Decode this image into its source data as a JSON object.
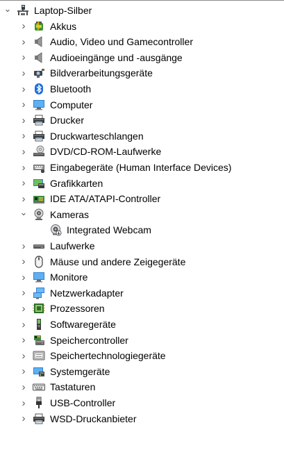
{
  "root": {
    "label": "Laptop-Silber",
    "icon": "computer-tree-icon",
    "expanded": true
  },
  "categories": [
    {
      "label": "Akkus",
      "icon": "battery-icon",
      "expanded": false
    },
    {
      "label": "Audio, Video und Gamecontroller",
      "icon": "speaker-icon",
      "expanded": false
    },
    {
      "label": "Audioeingänge und -ausgänge",
      "icon": "speaker-icon",
      "expanded": false
    },
    {
      "label": "Bildverarbeitungsgeräte",
      "icon": "camera-device-icon",
      "expanded": false
    },
    {
      "label": "Bluetooth",
      "icon": "bluetooth-icon",
      "expanded": false
    },
    {
      "label": "Computer",
      "icon": "monitor-icon",
      "expanded": false
    },
    {
      "label": "Drucker",
      "icon": "printer-icon",
      "expanded": false
    },
    {
      "label": "Druckwarteschlangen",
      "icon": "printer-icon",
      "expanded": false
    },
    {
      "label": "DVD/CD-ROM-Laufwerke",
      "icon": "dvd-drive-icon",
      "expanded": false
    },
    {
      "label": "Eingabegeräte (Human Interface Devices)",
      "icon": "hid-icon",
      "expanded": false
    },
    {
      "label": "Grafikkarten",
      "icon": "display-adapter-icon",
      "expanded": false
    },
    {
      "label": "IDE ATA/ATAPI-Controller",
      "icon": "ide-controller-icon",
      "expanded": false
    },
    {
      "label": "Kameras",
      "icon": "webcam-icon",
      "expanded": true,
      "children": [
        {
          "label": "Integrated Webcam",
          "icon": "webcam-child-icon"
        }
      ]
    },
    {
      "label": "Laufwerke",
      "icon": "disk-drive-icon",
      "expanded": false
    },
    {
      "label": "Mäuse und andere Zeigegeräte",
      "icon": "mouse-icon",
      "expanded": false
    },
    {
      "label": "Monitore",
      "icon": "monitor-icon",
      "expanded": false
    },
    {
      "label": "Netzwerkadapter",
      "icon": "network-adapter-icon",
      "expanded": false
    },
    {
      "label": "Prozessoren",
      "icon": "processor-icon",
      "expanded": false
    },
    {
      "label": "Softwaregeräte",
      "icon": "software-device-icon",
      "expanded": false
    },
    {
      "label": "Speichercontroller",
      "icon": "storage-controller-icon",
      "expanded": false
    },
    {
      "label": "Speichertechnologiegeräte",
      "icon": "memory-technology-icon",
      "expanded": false
    },
    {
      "label": "Systemgeräte",
      "icon": "system-device-icon",
      "expanded": false
    },
    {
      "label": "Tastaturen",
      "icon": "keyboard-icon",
      "expanded": false
    },
    {
      "label": "USB-Controller",
      "icon": "usb-icon",
      "expanded": false
    },
    {
      "label": "WSD-Druckanbieter",
      "icon": "printer-icon",
      "expanded": false
    }
  ]
}
